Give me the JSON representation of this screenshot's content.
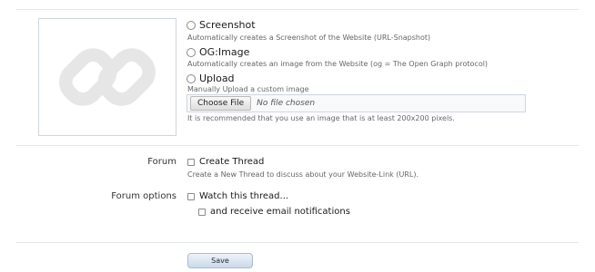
{
  "thumbnail": {
    "icon": "link-icon",
    "icon_color": "#e6e6e6"
  },
  "image_options": [
    {
      "label": "Screenshot",
      "hint": "Automatically creates a Screenshot of the Website (URL-Snapshot)"
    },
    {
      "label": "OG:Image",
      "hint": "Automatically creates an image from the Website (og = The Open Graph protocol)"
    },
    {
      "label": "Upload",
      "hint": "Manually Upload a custom image"
    }
  ],
  "file_input": {
    "button_label": "Choose File",
    "status": "No file chosen"
  },
  "image_recommendation": "It is recommended that you use an image that is at least 200x200 pixels.",
  "forum": {
    "label": "Forum",
    "create_thread_label": "Create Thread",
    "create_thread_hint": "Create a New Thread to discuss about your Website-Link (URL)."
  },
  "forum_options": {
    "label": "Forum options",
    "watch_thread_label": "Watch this thread...",
    "email_notifications_label": "and receive email notifications"
  },
  "save_button": {
    "label": "Save"
  }
}
